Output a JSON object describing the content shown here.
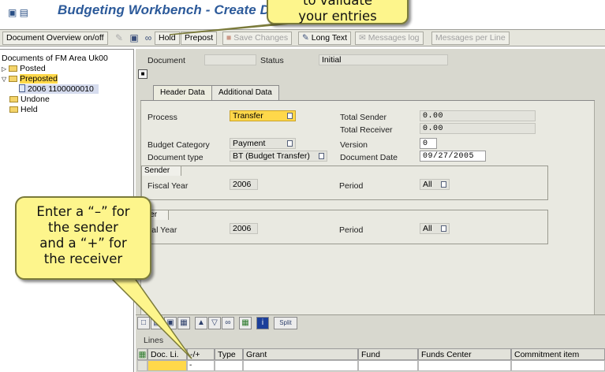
{
  "window": {
    "title": "Budgeting Workbench - Create Document"
  },
  "toolbar": {
    "document_overview": "Document Overview on/off",
    "hold": "Hold",
    "prepost": "Prepost",
    "save_changes": "Save Changes",
    "long_text": "Long Text",
    "messages_log": "Messages log",
    "messages_per_line": "Messages per Line"
  },
  "tree": {
    "root": "Documents of FM Area Uk00",
    "items": [
      {
        "label": "Posted"
      },
      {
        "label": "Preposted"
      },
      {
        "label": "2006  1100000010"
      },
      {
        "label": "Undone"
      },
      {
        "label": "Held"
      }
    ]
  },
  "header": {
    "document_label": "Document",
    "document_value": "",
    "status_label": "Status",
    "status_value": "Initial"
  },
  "tabs": [
    {
      "label": "Header Data"
    },
    {
      "label": "Additional Data"
    }
  ],
  "form": {
    "process_label": "Process",
    "process_value": "Transfer",
    "total_sender_label": "Total Sender",
    "total_sender_value": "0.00",
    "total_receiver_label": "Total Receiver",
    "total_receiver_value": "0.00",
    "budget_category_label": "Budget Category",
    "budget_category_value": "Payment",
    "version_label": "Version",
    "version_value": "0",
    "document_type_label": "Document type",
    "document_type_value": "BT (Budget Transfer)",
    "document_date_label": "Document Date",
    "document_date_value": "09/27/2005",
    "sender": {
      "title": "Sender",
      "fiscal_year_label": "Fiscal Year",
      "fiscal_year_value": "2006",
      "period_label": "Period",
      "period_value": "All"
    },
    "receiver": {
      "title": "iver",
      "fiscal_year_label": "cal Year",
      "fiscal_year_value": "2006",
      "period_label": "Period",
      "period_value": "All"
    }
  },
  "lines": {
    "caption": "Lines",
    "split_label": "Split",
    "columns": [
      "Doc. Li.",
      "-/+",
      "Type",
      "Grant",
      "Fund",
      "Funds Center",
      "Commitment item"
    ],
    "first_row_sign": "-"
  },
  "callouts": {
    "top": "to validate\nyour entries",
    "left": "Enter a “–” for\nthe sender\nand a “+” for\nthe receiver"
  },
  "colors": {
    "title": "#2c5a9a",
    "callout_fill": "#fdf58c",
    "required_field": "#ffd84a",
    "panel": "#d8d8cf"
  }
}
